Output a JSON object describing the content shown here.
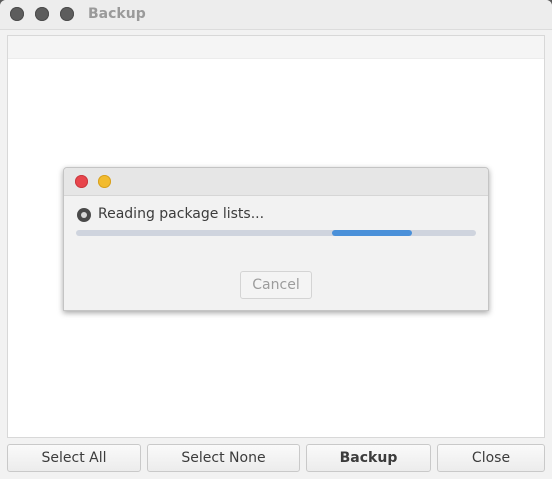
{
  "window": {
    "title": "Backup"
  },
  "footer": {
    "select_all_label": "Select All",
    "select_none_label": "Select None",
    "backup_label": "Backup",
    "close_label": "Close"
  },
  "dialog": {
    "status_text": "Reading package lists...",
    "progress": {
      "fill_start_fraction": 0.64,
      "fill_end_fraction": 0.84,
      "mode": "indeterminate"
    },
    "cancel_label": "Cancel"
  },
  "colors": {
    "accent": "#4a90d9",
    "close_button": "#e8454c",
    "minimize_button": "#f2bb2e"
  },
  "icons": {
    "window_controls": [
      "close-icon",
      "minimize-icon",
      "maximize-icon"
    ],
    "status": "spinner-icon"
  }
}
